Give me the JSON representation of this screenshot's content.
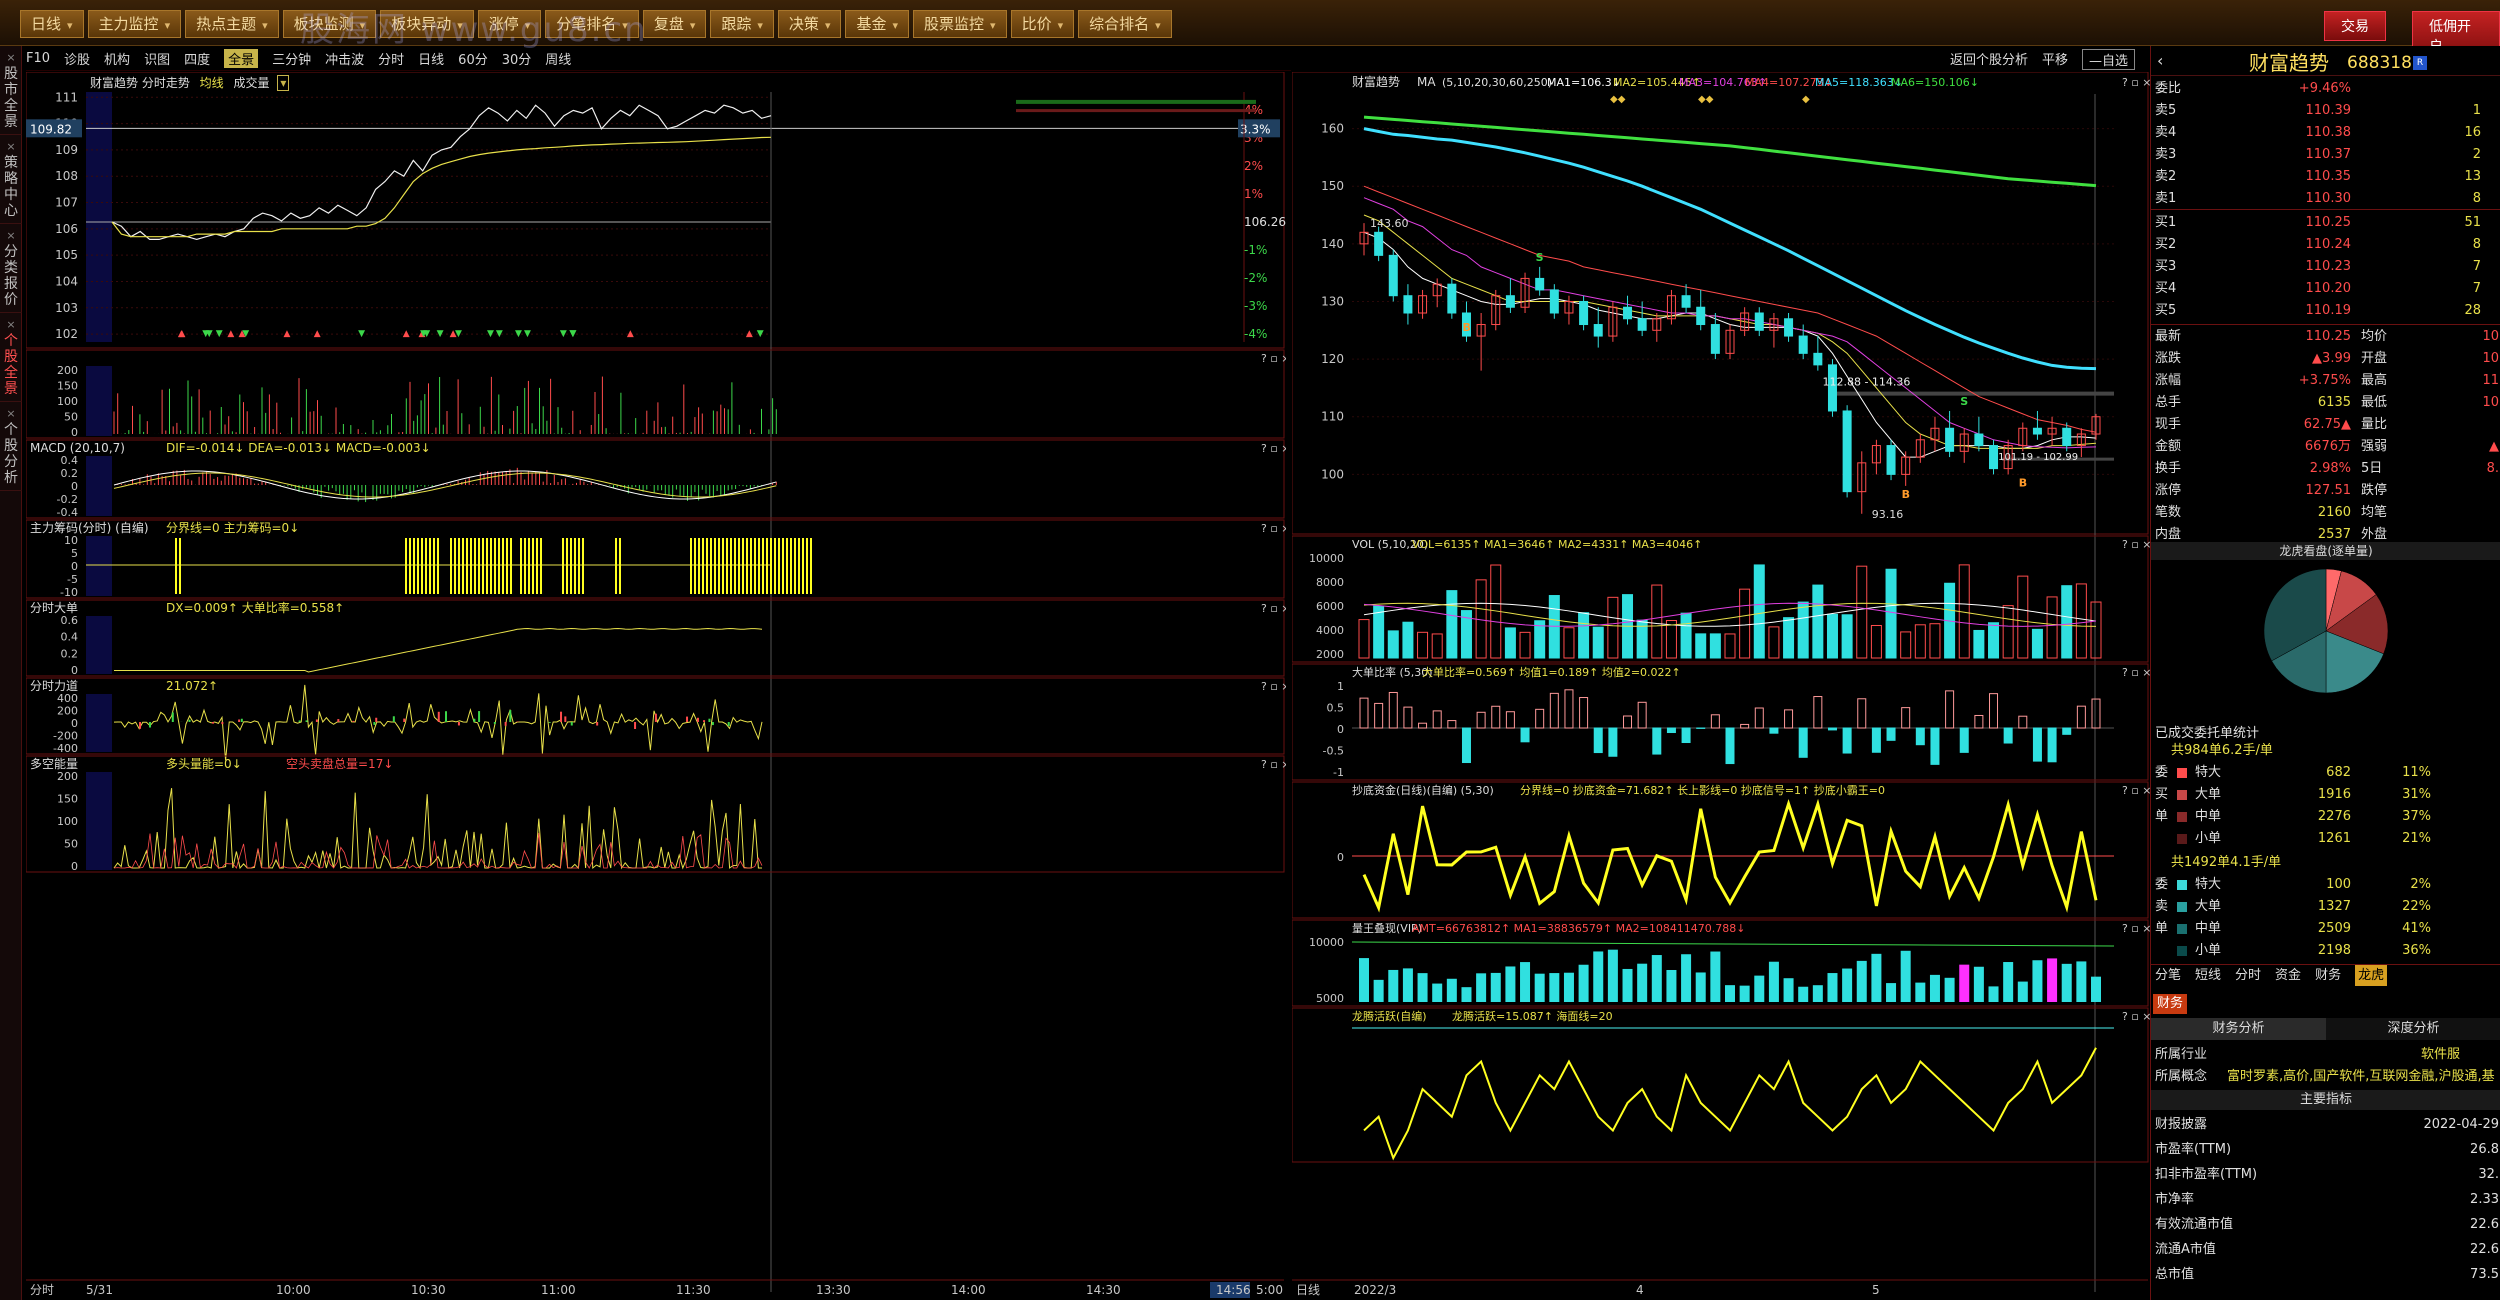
{
  "topbar": {
    "ribbon": [
      "日线",
      "主力监控",
      "热点主题",
      "板块监测",
      "板块异动",
      "涨停",
      "分笔排名",
      "复盘",
      "跟踪",
      "决策",
      "基金",
      "股票监控",
      "比价",
      "综合排名"
    ],
    "btn_trade": "交易",
    "btn_open": "低佣开户",
    "watermark": "股海网 www.gu8.cn"
  },
  "lefttabs": [
    "股市全景",
    "策略中心",
    "分类报价",
    "个股全景",
    "个股分析"
  ],
  "toolbar": {
    "items": [
      "F10",
      "诊股",
      "机构",
      "识图",
      "四度",
      "全景",
      "三分钟",
      "冲击波",
      "分时",
      "日线",
      "60分",
      "30分",
      "周线"
    ],
    "active": "全景",
    "right": [
      "返回个股分析",
      "平移",
      "—自选"
    ]
  },
  "intraday": {
    "title": "财富趋势  分时走势",
    "legend_avg": "均线",
    "legend_vol": "成交量",
    "price_ticks": [
      "111",
      "110",
      "109",
      "108",
      "107",
      "106",
      "105",
      "104",
      "103",
      "102"
    ],
    "pct_ticks": [
      "4%",
      "3%",
      "2%",
      "1%",
      "",
      "-1%",
      "-2%",
      "-3%",
      "-4%"
    ],
    "prev_close": "106.26",
    "cursor_price": "109.82",
    "cursor_pct": "3.3%",
    "time_ticks": [
      "5/31",
      "10:00",
      "10:30",
      "11:00",
      "11:30",
      "13:30",
      "14:00",
      "14:30",
      "14:56",
      "5:00"
    ],
    "bottom_label": "分时",
    "price": [
      106.26,
      106.1,
      105.7,
      105.9,
      105.6,
      105.6,
      105.7,
      105.8,
      105.7,
      105.6,
      105.7,
      105.8,
      105.7,
      105.9,
      106.0,
      106.4,
      106.6,
      106.5,
      106.3,
      106.6,
      106.4,
      106.5,
      106.8,
      106.6,
      106.9,
      106.7,
      106.5,
      106.8,
      107.5,
      107.8,
      108.2,
      108.0,
      108.6,
      108.2,
      108.8,
      109.0,
      109.1,
      109.5,
      109.8,
      110.3,
      110.6,
      110.4,
      110.1,
      110.5,
      110.2,
      110.7,
      110.4,
      109.9,
      110.3,
      110.5,
      110.4,
      110.6,
      109.8,
      110.2,
      110.5,
      110.3,
      110.7,
      110.5,
      110.3,
      109.8,
      109.9,
      110.1,
      110.3,
      110.5,
      110.4,
      110.7,
      110.6,
      110.4,
      110.5,
      110.2,
      110.3
    ],
    "avg": [
      106.26,
      105.8,
      105.7,
      105.7,
      105.7,
      105.7,
      105.7,
      105.7,
      105.7,
      105.8,
      105.8,
      105.8,
      105.8,
      105.9,
      105.9,
      105.9,
      105.9,
      105.9,
      106.0,
      106.0,
      106.0,
      106.0,
      106.0,
      106.0,
      106.0,
      106.0,
      106.1,
      106.1,
      106.2,
      106.4,
      106.8,
      107.3,
      107.8,
      108.1,
      108.3,
      108.45,
      108.55,
      108.65,
      108.75,
      108.82,
      108.88,
      108.92,
      108.96,
      109.0,
      109.03,
      109.05,
      109.08,
      109.1,
      109.12,
      109.15,
      109.17,
      109.19,
      109.2,
      109.22,
      109.23,
      109.25,
      109.26,
      109.27,
      109.28,
      109.29,
      109.3,
      109.31,
      109.33,
      109.35,
      109.37,
      109.39,
      109.41,
      109.43,
      109.45,
      109.47,
      109.48
    ],
    "sub_panels": [
      {
        "title": "",
        "ticks": [
          "200",
          "150",
          "100",
          "50",
          "0"
        ]
      },
      {
        "title": "MACD (20,10,7)",
        "text": "DIF=-0.014↓ DEA=-0.013↓ MACD=-0.003↓",
        "ticks": [
          "0.4",
          "0.2",
          "0",
          "-0.2",
          "-0.4"
        ]
      },
      {
        "title": "主力筹码(分时) (自编)",
        "text": "分界线=0 主力筹码=0↓",
        "ticks": [
          "10",
          "5",
          "0",
          "-5",
          "-10"
        ]
      },
      {
        "title": "分时大单",
        "text": "DX=0.009↑ 大单比率=0.558↑",
        "ticks": [
          "0.6",
          "0.4",
          "0.2",
          "0"
        ]
      },
      {
        "title": "分时力道",
        "text": "21.072↑",
        "ticks": [
          "400",
          "200",
          "0",
          "-200",
          "-400"
        ]
      },
      {
        "title": "多空能量",
        "text": "多头量能=0↓",
        "text2": "空头卖盘总量=17↓",
        "ticks": [
          "200",
          "150",
          "100",
          "50",
          "0"
        ]
      }
    ]
  },
  "daily": {
    "title": "财富趋势",
    "ma_label": "MA",
    "ma_params": "(5,10,20,30,60,250)",
    "ma": [
      "MA1=106.3↓",
      "MA2=105.445↑",
      "MA3=104.763↑",
      "MA4=107.273↓",
      "MA5=118.363↓",
      "MA6=150.106↓"
    ],
    "ma_colors": [
      "#ffffff",
      "#e8e04a",
      "#e040e0",
      "#ff4c4c",
      "#40e0ff",
      "#40e040"
    ],
    "ticks": [
      "160",
      "150",
      "140",
      "130",
      "120",
      "110",
      "100"
    ],
    "annot": {
      "high": "143.60",
      "low": "93.16",
      "range": "112.88 - 114.36",
      "r2": "101.19 - 102.99"
    },
    "date_ticks": [
      "2022/3",
      "4",
      "5"
    ],
    "bottom_label": "日线",
    "sub_panels": [
      {
        "title": "VOL (5,10,20)",
        "text": "VOL=6135↑ MA1=3646↑ MA2=4331↑ MA3=4046↑",
        "ticks": [
          "10000",
          "8000",
          "6000",
          "4000",
          "2000"
        ]
      },
      {
        "title": "大单比率 (5,30)",
        "text": "大单比率=0.569↑ 均值1=0.189↑ 均值2=0.022↑",
        "ticks": [
          "1",
          "0.5",
          "0",
          "-0.5",
          "-1"
        ]
      },
      {
        "title": "抄底资金(日线)(自编) (5,30)",
        "text": "分界线=0 抄底资金=71.682↑ 长上影线=0 抄底信号=1↑ 抄底小霸王=0",
        "ticks": [
          "0"
        ]
      },
      {
        "title": "量王叠现(VIP)",
        "text": "AMT=66763812↑ MA1=38836579↑ MA2=108411470.788↓",
        "ticks": [
          "10000",
          "5000"
        ]
      },
      {
        "title": "龙腾活跃(自编)",
        "text": "龙腾活跃=15.087↑ 海面线=20",
        "ticks": []
      }
    ],
    "candles": [
      [
        140,
        143.6,
        138,
        142
      ],
      [
        142,
        143,
        137,
        138
      ],
      [
        138,
        139,
        130,
        131
      ],
      [
        131,
        133,
        126,
        128
      ],
      [
        128,
        132,
        127,
        131
      ],
      [
        131,
        134,
        129,
        133
      ],
      [
        133,
        134,
        127,
        128
      ],
      [
        128,
        130,
        123,
        124
      ],
      [
        124,
        128,
        118,
        126
      ],
      [
        126,
        132,
        125,
        131
      ],
      [
        131,
        134,
        128,
        129
      ],
      [
        129,
        135,
        128,
        134
      ],
      [
        134,
        136,
        131,
        132
      ],
      [
        132,
        133,
        127,
        128
      ],
      [
        128,
        131,
        126,
        130
      ],
      [
        130,
        131,
        125,
        126
      ],
      [
        126,
        129,
        122,
        124
      ],
      [
        124,
        130,
        123,
        129
      ],
      [
        129,
        131,
        126,
        127
      ],
      [
        127,
        130,
        124,
        125
      ],
      [
        125,
        128,
        123,
        127
      ],
      [
        127,
        132,
        126,
        131
      ],
      [
        131,
        133,
        128,
        129
      ],
      [
        129,
        132,
        125,
        126
      ],
      [
        126,
        128,
        120,
        121
      ],
      [
        121,
        126,
        120,
        125
      ],
      [
        125,
        129,
        124,
        128
      ],
      [
        128,
        129,
        124,
        125
      ],
      [
        125,
        128,
        122,
        127
      ],
      [
        127,
        128,
        123,
        124
      ],
      [
        124,
        126,
        120,
        121
      ],
      [
        121,
        124,
        118,
        119
      ],
      [
        119,
        120,
        110,
        111
      ],
      [
        111,
        112,
        96,
        97
      ],
      [
        97,
        104,
        93.16,
        102
      ],
      [
        102,
        106,
        100,
        105
      ],
      [
        105,
        106,
        99,
        100
      ],
      [
        100,
        104,
        98,
        103
      ],
      [
        103,
        107,
        102,
        106
      ],
      [
        106,
        110,
        104,
        108
      ],
      [
        108,
        111,
        103,
        104
      ],
      [
        104,
        108,
        102,
        107
      ],
      [
        107,
        110,
        104,
        105
      ],
      [
        105,
        106,
        100,
        101
      ],
      [
        101,
        106,
        100,
        105
      ],
      [
        105,
        109,
        104,
        108
      ],
      [
        108,
        111,
        106,
        107
      ],
      [
        107,
        110,
        105,
        108
      ],
      [
        108,
        109,
        104,
        105
      ],
      [
        105,
        108,
        103,
        107
      ],
      [
        107,
        110.5,
        106,
        110
      ]
    ],
    "ma_lines": [
      {
        "c": "#ffffff",
        "v": [
          142,
          141,
          139,
          136,
          134,
          133,
          132,
          131,
          130,
          129.5,
          129.5,
          130,
          130.5,
          130.5,
          130,
          129.5,
          128.5,
          128,
          127.5,
          127,
          127,
          127.5,
          128,
          128,
          127,
          126,
          125.5,
          125.5,
          125.5,
          125.5,
          125,
          124,
          121,
          117,
          113,
          109,
          106,
          103,
          103,
          104,
          105,
          105,
          105,
          105,
          104.5,
          104.5,
          105,
          106,
          106.5,
          106.5,
          106.3
        ]
      },
      {
        "c": "#e8e04a",
        "v": [
          145,
          144,
          142,
          140,
          138,
          136,
          134,
          133,
          132,
          131,
          130,
          130,
          130,
          130,
          130,
          130,
          129.5,
          129,
          128.5,
          128,
          127.5,
          127.5,
          127.5,
          127.5,
          127.5,
          127,
          126.5,
          126,
          126,
          125.5,
          125,
          124.5,
          123,
          121,
          118,
          115,
          112,
          109,
          107,
          106,
          105,
          105,
          104.5,
          104.5,
          104.5,
          104.5,
          104.5,
          105,
          105,
          105.2,
          105.4
        ]
      },
      {
        "c": "#e040e0",
        "v": [
          148,
          147,
          146,
          144,
          143,
          141,
          139,
          138,
          136,
          135,
          134,
          133,
          132,
          132,
          131.5,
          131,
          130.5,
          130,
          129.5,
          129,
          128.5,
          128,
          128,
          127.5,
          127.5,
          127,
          127,
          126.5,
          126,
          125.5,
          125,
          124.5,
          124,
          123,
          121,
          119,
          117,
          115,
          113,
          111,
          109,
          108,
          107,
          106,
          105.5,
          105,
          104.8,
          104.7,
          104.6,
          104.7,
          104.76
        ]
      },
      {
        "c": "#ff4c4c",
        "v": [
          150,
          149,
          148,
          147,
          146,
          145,
          144,
          143,
          142,
          141,
          140,
          139,
          138,
          137.5,
          137,
          136,
          135.5,
          135,
          134.5,
          134,
          133.5,
          133,
          132.5,
          132,
          131.5,
          131,
          130.5,
          130,
          129.5,
          129,
          128.5,
          128,
          127,
          126,
          125,
          124,
          122.5,
          121,
          119.5,
          118,
          116.5,
          115,
          113.5,
          112.5,
          111.5,
          110.5,
          109.5,
          109,
          108.5,
          107.8,
          107.3
        ]
      },
      {
        "c": "#40e0ff",
        "v": [
          160,
          159.5,
          159,
          158.8,
          158.5,
          158.2,
          158,
          157.6,
          157.2,
          156.8,
          156.3,
          155.8,
          155.2,
          154.6,
          154,
          153.3,
          152.5,
          151.7,
          150.9,
          150,
          149,
          148,
          147,
          146,
          144.8,
          143.6,
          142.4,
          141.2,
          140,
          138.8,
          137.5,
          136.2,
          134.9,
          133.6,
          132.3,
          131,
          129.7,
          128.4,
          127.2,
          126,
          124.9,
          123.8,
          122.8,
          121.9,
          121,
          120.2,
          119.5,
          118.9,
          118.6,
          118.4,
          118.36
        ]
      },
      {
        "c": "#40e040",
        "v": [
          162,
          161.8,
          161.6,
          161.4,
          161.2,
          161,
          160.8,
          160.6,
          160.4,
          160.2,
          160,
          159.8,
          159.6,
          159.4,
          159.2,
          159,
          158.8,
          158.6,
          158.4,
          158.2,
          158,
          157.8,
          157.6,
          157.4,
          157.2,
          157,
          156.7,
          156.4,
          156.1,
          155.8,
          155.5,
          155.2,
          154.9,
          154.6,
          154.3,
          154,
          153.7,
          153.4,
          153.1,
          152.8,
          152.5,
          152.2,
          151.9,
          151.6,
          151.3,
          151.1,
          150.9,
          150.7,
          150.5,
          150.3,
          150.1
        ]
      }
    ],
    "active_line": [
      11,
      12,
      9,
      11,
      14,
      13,
      12,
      15,
      16,
      13,
      11,
      13,
      15,
      14,
      16,
      14,
      12,
      11,
      13,
      14,
      12,
      11,
      15,
      13,
      12,
      11,
      13,
      15,
      14,
      16,
      13,
      12,
      11,
      12,
      14,
      15,
      13,
      14,
      16,
      15,
      14,
      13,
      12,
      11,
      13,
      14,
      16,
      13,
      14,
      15,
      17
    ]
  },
  "quote": {
    "name": "财富趋势",
    "code": "688318",
    "webi": "委比",
    "webi_val": "+9.46%",
    "sell": [
      [
        "卖5",
        "110.39",
        "1"
      ],
      [
        "卖4",
        "110.38",
        "16"
      ],
      [
        "卖3",
        "110.37",
        "2"
      ],
      [
        "卖2",
        "110.35",
        "13"
      ],
      [
        "卖1",
        "110.30",
        "8"
      ]
    ],
    "buy": [
      [
        "买1",
        "110.25",
        "51"
      ],
      [
        "买2",
        "110.24",
        "8"
      ],
      [
        "买3",
        "110.23",
        "7"
      ],
      [
        "买4",
        "110.20",
        "7"
      ],
      [
        "买5",
        "110.19",
        "28"
      ]
    ],
    "stats": [
      [
        "最新",
        "110.25",
        "均价",
        "10"
      ],
      [
        "涨跌",
        "▲3.99",
        "开盘",
        "10"
      ],
      [
        "涨幅",
        "+3.75%",
        "最高",
        "11"
      ],
      [
        "总手",
        "6135",
        "最低",
        "10"
      ],
      [
        "现手",
        "62.75▲",
        "量比",
        ""
      ],
      [
        "金额",
        "6676万",
        "强弱",
        "▲"
      ],
      [
        "换手",
        "2.98%",
        "5日",
        "8."
      ],
      [
        "涨停",
        "127.51",
        "跌停",
        ""
      ],
      [
        "笔数",
        "2160",
        "均笔",
        ""
      ],
      [
        "内盘",
        "2537",
        "外盘",
        ""
      ]
    ],
    "pie_title": "龙虎看盘(逐单量)",
    "pie": [
      0.11,
      0.31,
      0.37,
      0.21
    ],
    "pie_colors": [
      "#ff6a6a",
      "#b23030",
      "#2a8a8a",
      "#1a5a5a"
    ],
    "order_title": "已成交委托单统计",
    "buy_group": "共984单6.2手/单",
    "buy_rows": [
      [
        "委",
        "特大",
        "682",
        "11%"
      ],
      [
        "买",
        "大单",
        "1916",
        "31%"
      ],
      [
        "单",
        "中单",
        "2276",
        "37%"
      ],
      [
        "",
        "小单",
        "1261",
        "21%"
      ]
    ],
    "sell_group": "共1492单4.1手/单",
    "sell_rows": [
      [
        "委",
        "特大",
        "100",
        "2%"
      ],
      [
        "卖",
        "大单",
        "1327",
        "22%"
      ],
      [
        "单",
        "中单",
        "2509",
        "41%"
      ],
      [
        "",
        "小单",
        "2198",
        "36%"
      ]
    ],
    "tabs": [
      "分笔",
      "短线",
      "分时",
      "资金",
      "财务",
      "龙虎"
    ],
    "fin_tab": "财务",
    "fin_subtabs": [
      "财务分析",
      "深度分析"
    ],
    "industry_k": "所属行业",
    "industry_v": "软件服",
    "concept_k": "所属概念",
    "concept_v": "富时罗素,高价,国产软件,互联网金融,沪股通,基",
    "main_idx": "主要指标",
    "fin_rows": [
      [
        "财报披露",
        "2022-04-29"
      ],
      [
        "市盈率(TTM)",
        "26.8"
      ],
      [
        "扣非市盈率(TTM)",
        "32."
      ],
      [
        "市净率",
        "2.33"
      ],
      [
        "有效流通市值",
        "22.6"
      ],
      [
        "流通A市值",
        "22.6"
      ],
      [
        "总市值",
        "73.5"
      ]
    ]
  }
}
